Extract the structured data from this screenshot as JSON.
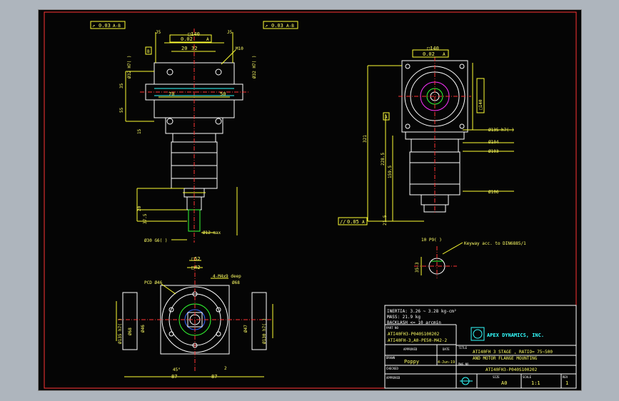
{
  "drawing": {
    "notes": {
      "inertia": "INERTIA: 3.26 ~ 3.28 kg-cm²",
      "mass": "MASS: 21.9 kg",
      "backlash": "BACKLASH <= 10 arcmin"
    },
    "part_no_label": "PART NO",
    "part_no_1": "ATI40FH3-P040S100202",
    "part_no_2": "ATI40FH-3,A0-PE50-M42-2",
    "approved_label": "APPROVED",
    "date_label": "DATE",
    "drawn_label": "DRAWN",
    "drawn_by": "Poppy",
    "drawn_date": "4-Jun-19",
    "checked_label": "CHECKED",
    "approved2_label": "APPROVED",
    "company": "APEX DYNAMICS, INC.",
    "title_label": "TITLE",
    "title_1": "ATI40FH 3 STAGE , RATIO= 75~500",
    "title_2": "AND MOTOR FLANGE MOUNTING",
    "dwg_no_label": "DWG NO",
    "dwg_no": "ATI40FH3-P040S100202",
    "size_label": "SIZE",
    "size": "A0",
    "scale_label": "SCALE",
    "scale": "1:1",
    "rev_label": "REV",
    "rev": "1",
    "keyway_note": "Keyway acc. to DIN6885/1"
  },
  "dims": {
    "tol1": "0.03",
    "tol1_ref": "A-B",
    "tol2": "0.03",
    "tol2_ref": "A-B",
    "sq140": "□140",
    "perp": "0.02",
    "perp_ref": "A",
    "j5a": "J5",
    "j5b": "J5",
    "d20": "20",
    "d32": "32",
    "m10": "M10",
    "phi32_h7": "Ø32 H7( )",
    "d70": "70",
    "d50": "50",
    "d35": "35",
    "d55": "55",
    "d15": "15",
    "ref_b": "B",
    "d20b": "20",
    "d37": "37.5",
    "phi30": "Ø30 G6( )",
    "phi12": "Ø12 max",
    "sq140b": "□140",
    "perp2": "0.02",
    "perp2_ref": "A",
    "ref_a": "A",
    "phi135": "Ø135 h7( )",
    "phi104": "Ø104",
    "phi103": "Ø103",
    "phi106": "Ø106",
    "d321": "321",
    "d2285": "228.5",
    "d1595": "159.5",
    "d215": "21.5",
    "par": "0.05",
    "par_ref": "A",
    "d10p9": "10 P9( )",
    "d353": "35.3",
    "sq52": "□52",
    "sq42": "□42",
    "m4": "4-M4x9 deep",
    "pcd": "PCD Ø46",
    "phi68": "Ø68",
    "phi47": "Ø47",
    "phi135b": "Ø135 h7( )",
    "phi130": "Ø130 h7( )",
    "phi68b": "Ø68",
    "phi46b": "Ø46",
    "ang45": "45°",
    "d2": "2",
    "d87a": "87",
    "d87b": "87"
  }
}
